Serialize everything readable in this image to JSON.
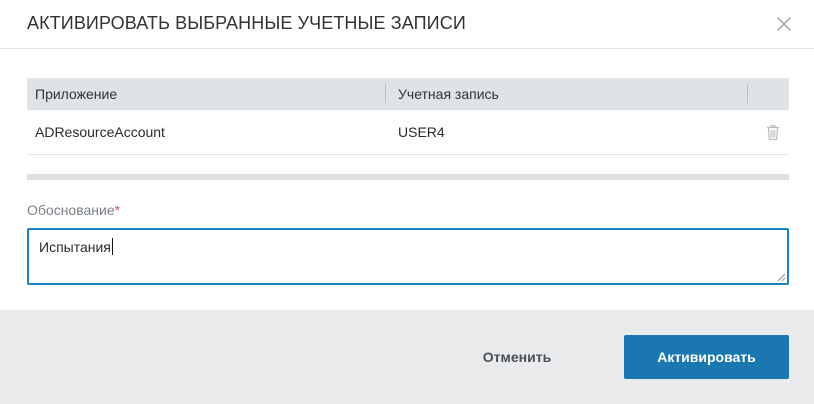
{
  "dialog": {
    "title": "АКТИВИРОВАТЬ ВЫБРАННЫЕ УЧЕТНЫЕ ЗАПИСИ",
    "close_icon": "close-icon"
  },
  "table": {
    "columns": [
      "Приложение",
      "Учетная запись"
    ],
    "rows": [
      {
        "application": "ADResourceAccount",
        "account": "USER4",
        "action_icon": "trash-icon"
      }
    ]
  },
  "justification": {
    "label": "Обоснование",
    "required_mark": "*",
    "value": "Испытания"
  },
  "footer": {
    "cancel_label": "Отменить",
    "submit_label": "Активировать"
  },
  "colors": {
    "accent": "#1a77b0",
    "focus_border": "#1a82c4",
    "header_bg": "#dde3e7",
    "footer_bg": "#e9eaeb",
    "required": "#d9534f"
  }
}
